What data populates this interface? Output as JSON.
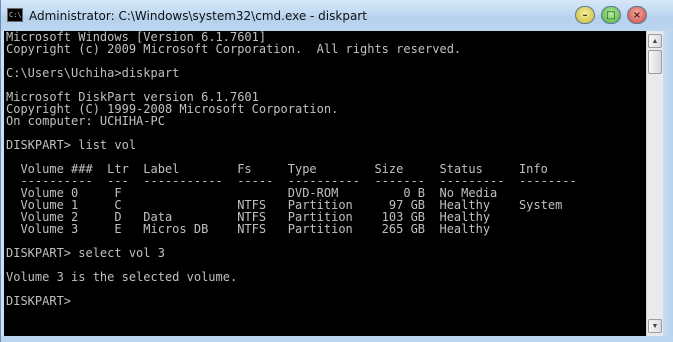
{
  "window": {
    "title": "Administrator: C:\\Windows\\system32\\cmd.exe - diskpart",
    "app_icon_text": "C:\\",
    "minimize_glyph": "–",
    "maximize_glyph": "□",
    "close_glyph": "×"
  },
  "colors": {
    "console_background": "#000000",
    "console_text": "#c0c0c0"
  },
  "console": {
    "lines": [
      "Microsoft Windows [Version 6.1.7601]",
      "Copyright (c) 2009 Microsoft Corporation.  All rights reserved.",
      "",
      "C:\\Users\\Uchiha>diskpart",
      "",
      "Microsoft DiskPart version 6.1.7601",
      "Copyright (C) 1999-2008 Microsoft Corporation.",
      "On computer: UCHIHA-PC",
      "",
      "DISKPART> list vol",
      "",
      "  Volume ###  Ltr  Label        Fs     Type        Size     Status     Info",
      "  ----------  ---  -----------  -----  ----------  -------  ---------  --------",
      "  Volume 0     F                       DVD-ROM         0 B  No Media",
      "  Volume 1     C                NTFS   Partition     97 GB  Healthy    System",
      "  Volume 2     D   Data         NTFS   Partition    103 GB  Healthy",
      "  Volume 3     E   Micros DB    NTFS   Partition    265 GB  Healthy",
      "",
      "DISKPART> select vol 3",
      "",
      "Volume 3 is the selected volume.",
      "",
      "DISKPART>"
    ]
  },
  "scrollbar": {
    "up_icon": "▲",
    "down_icon": "▼"
  }
}
